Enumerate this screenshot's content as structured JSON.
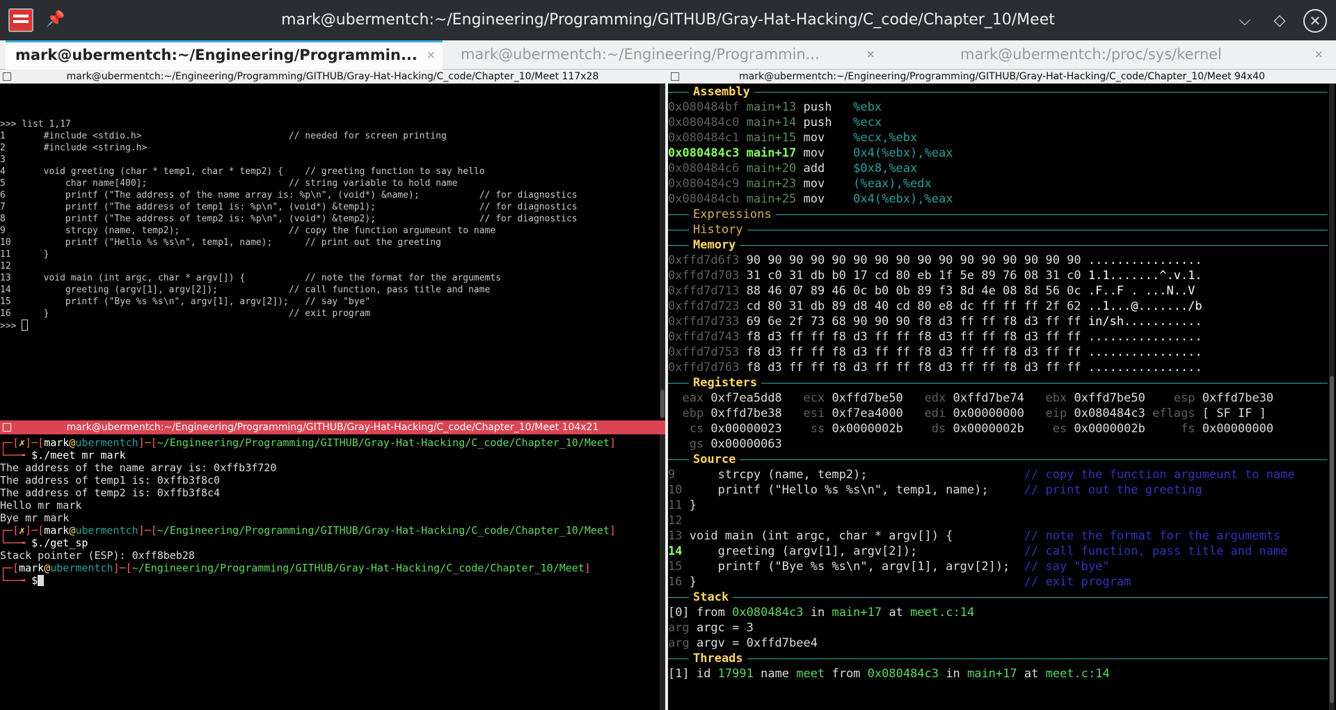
{
  "window": {
    "title": "mark@ubermentch:~/Engineering/Programming/GITHUB/Gray-Hat-Hacking/C_code/Chapter_10/Meet"
  },
  "tabs": [
    {
      "label": "mark@ubermentch:~/Engineering/Programmin...",
      "close": "×"
    },
    {
      "label": "mark@ubermentch:~/Engineering/Programmin...",
      "close": "×"
    },
    {
      "label": "mark@ubermentch:/proc/sys/kernel",
      "close": "×"
    }
  ],
  "panes": {
    "left_top_title": "mark@ubermentch:~/Engineering/Programming/GITHUB/Gray-Hat-Hacking/C_code/Chapter_10/Meet 117x28",
    "left_bottom_title": "mark@ubermentch:~/Engineering/Programming/GITHUB/Gray-Hat-Hacking/C_code/Chapter_10/Meet 104x21",
    "right_title": "mark@ubermentch:~/Engineering/Programming/GITHUB/Gray-Hat-Hacking/C_code/Chapter_10/Meet 94x40"
  },
  "gdb_listing": {
    "command": ">>> list 1,17",
    "lines": [
      "1       #include <stdio.h>                           // needed for screen printing",
      "2       #include <string.h>",
      "3",
      "4       void greeting (char * temp1, char * temp2) {    // greeting function to say hello",
      "5           char name[400];                          // string variable to hold name",
      "6           printf (\"The address of the name array is: %p\\n\", (void*) &name);           // for diagnostics",
      "7           printf (\"The address of temp1 is: %p\\n\", (void*) &temp1);                   // for diagnostics",
      "8           printf (\"The address of temp2 is: %p\\n\", (void*) &temp2);                   // for diagnostics",
      "9           strcpy (name, temp2);                    // copy the function argumeunt to name",
      "10          printf (\"Hello %s %s\\n\", temp1, name);      // print out the greeting",
      "11      }",
      "12",
      "13      void main (int argc, char * argv[]) {           // note the format for the argumemts",
      "14          greeting (argv[1], argv[2]);             // call function, pass title and name",
      "15          printf (\"Bye %s %s\\n\", argv[1], argv[2]);   // say \"bye\"",
      "16      }                                            // exit program"
    ],
    "prompt": ">>> "
  },
  "shell": {
    "prompt_user": "mark",
    "prompt_at": "@",
    "prompt_host": "ubermentch",
    "cwd": "~/Engineering/Programming/GITHUB/Gray-Hat-Hacking/C_code/Chapter_10/Meet",
    "fail_mark": "✗",
    "cmd1": "$./meet mr mark",
    "out1": [
      "The address of the name array is: 0xffb3f720",
      "The address of temp1 is: 0xffb3f8c0",
      "The address of temp2 is: 0xffb3f8c4",
      "Hello mr mark",
      "Bye mr mark"
    ],
    "cmd2": "$./get_sp",
    "out2": [
      "Stack pointer (ESP): 0xff8beb28"
    ],
    "cmd3": "$"
  },
  "dashboard": {
    "sections": {
      "assembly": "Assembly",
      "expressions": "Expressions",
      "history": "History",
      "memory": "Memory",
      "registers": "Registers",
      "source": "Source",
      "stack": "Stack",
      "threads": "Threads"
    },
    "assembly": [
      {
        "addr": "0x080484bf",
        "sym": "main+13",
        "op": "push",
        "args": "%ebx",
        "cur": false
      },
      {
        "addr": "0x080484c0",
        "sym": "main+14",
        "op": "push",
        "args": "%ecx",
        "cur": false
      },
      {
        "addr": "0x080484c1",
        "sym": "main+15",
        "op": "mov",
        "args": "%ecx,%ebx",
        "cur": false
      },
      {
        "addr": "0x080484c3",
        "sym": "main+17",
        "op": "mov",
        "args": "0x4(%ebx),%eax",
        "cur": true
      },
      {
        "addr": "0x080484c6",
        "sym": "main+20",
        "op": "add",
        "args": "$0x8,%eax",
        "cur": false
      },
      {
        "addr": "0x080484c9",
        "sym": "main+23",
        "op": "mov",
        "args": "(%eax),%edx",
        "cur": false
      },
      {
        "addr": "0x080484cb",
        "sym": "main+25",
        "op": "mov",
        "args": "0x4(%ebx),%eax",
        "cur": false
      }
    ],
    "memory": [
      {
        "addr": "0xffd7d6f3",
        "hex": "90 90 90 90 90 90 90 90 90 90 90 90 90 90 90 90",
        "ascii": "................"
      },
      {
        "addr": "0xffd7d703",
        "hex": "31 c0 31 db b0 17 cd 80 eb 1f 5e 89 76 08 31 c0",
        "ascii": "1.1.......^.v.1."
      },
      {
        "addr": "0xffd7d713",
        "hex": "88 46 07 89 46 0c b0 0b 89 f3 8d 4e 08 8d 56 0c",
        "ascii": ".F..F . ...N..V"
      },
      {
        "addr": "0xffd7d723",
        "hex": "cd 80 31 db 89 d8 40 cd 80 e8 dc ff ff ff 2f 62",
        "ascii": "..1...@......./b"
      },
      {
        "addr": "0xffd7d733",
        "hex": "69 6e 2f 73 68 90 90 90 f8 d3 ff ff f8 d3 ff ff",
        "ascii": "in/sh..........."
      },
      {
        "addr": "0xffd7d743",
        "hex": "f8 d3 ff ff f8 d3 ff ff f8 d3 ff ff f8 d3 ff ff",
        "ascii": "................"
      },
      {
        "addr": "0xffd7d753",
        "hex": "f8 d3 ff ff f8 d3 ff ff f8 d3 ff ff f8 d3 ff ff",
        "ascii": "................"
      },
      {
        "addr": "0xffd7d763",
        "hex": "f8 d3 ff ff f8 d3 ff ff f8 d3 ff ff f8 d3 ff ff",
        "ascii": "................"
      }
    ],
    "registers": [
      [
        [
          "eax",
          "0xf7ea5dd8"
        ],
        [
          "ecx",
          "0xffd7be50"
        ],
        [
          "edx",
          "0xffd7be74"
        ],
        [
          "ebx",
          "0xffd7be50"
        ],
        [
          "esp",
          "0xffd7be30"
        ]
      ],
      [
        [
          "ebp",
          "0xffd7be38"
        ],
        [
          "esi",
          "0xf7ea4000"
        ],
        [
          "edi",
          "0x00000000"
        ],
        [
          "eip",
          "0x080484c3"
        ],
        [
          "eflags",
          "[ SF IF ]"
        ]
      ],
      [
        [
          "cs",
          "0x00000023"
        ],
        [
          "ss",
          "0x0000002b"
        ],
        [
          "ds",
          "0x0000002b"
        ],
        [
          "es",
          "0x0000002b"
        ],
        [
          "fs",
          "0x00000000"
        ]
      ],
      [
        [
          "gs",
          "0x00000063"
        ]
      ]
    ],
    "source": [
      {
        "n": "9",
        "code": "    strcpy (name, temp2);",
        "comment": "// copy the function argumeunt to name"
      },
      {
        "n": "10",
        "code": "    printf (\"Hello %s %s\\n\", temp1, name);",
        "comment": "// print out the greeting"
      },
      {
        "n": "11",
        "code": "}",
        "comment": ""
      },
      {
        "n": "12",
        "code": "",
        "comment": ""
      },
      {
        "n": "13",
        "code": "void main (int argc, char * argv[]) {",
        "comment": "// note the format for the argumemts"
      },
      {
        "n": "14",
        "code": "    greeting (argv[1], argv[2]);",
        "comment": "// call function, pass title and name"
      },
      {
        "n": "15",
        "code": "    printf (\"Bye %s %s\\n\", argv[1], argv[2]);",
        "comment": "// say \"bye\""
      },
      {
        "n": "16",
        "code": "}",
        "comment": "// exit program"
      }
    ],
    "stack": {
      "frame": "[0]",
      "from": "from",
      "addr": "0x080484c3",
      "in": "in",
      "fn": "main+17",
      "at": "at",
      "loc": "meet.c:14",
      "args": [
        {
          "kw": "arg",
          "text": "argc = 3"
        },
        {
          "kw": "arg",
          "text": "argv = 0xffd7bee4"
        }
      ]
    },
    "threads": {
      "idx": "[1]",
      "id_kw": "id",
      "id": "17991",
      "name_kw": "name",
      "name": "meet",
      "from": "from",
      "addr": "0x080484c3",
      "in": "in",
      "fn": "main+17",
      "at": "at",
      "loc": "meet.c:14"
    }
  }
}
